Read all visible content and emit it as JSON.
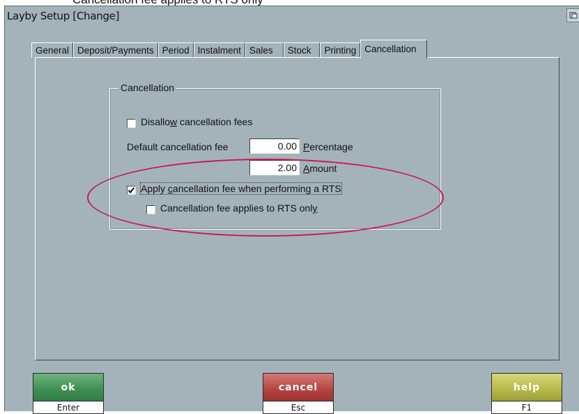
{
  "caption": "Cancellation fee applies to RTS only",
  "window": {
    "title": "Layby Setup  [Change]"
  },
  "tabs": [
    {
      "label": "General"
    },
    {
      "label": "Deposit/Payments"
    },
    {
      "label": "Period"
    },
    {
      "label": "Instalment"
    },
    {
      "label": "Sales"
    },
    {
      "label": "Stock"
    },
    {
      "label": "Printing"
    },
    {
      "label": "Cancellation",
      "active": true
    }
  ],
  "cancellation": {
    "group_title": "Cancellation",
    "disallow_fees": {
      "label_pre": "Disallo",
      "label_u": "w",
      "label_post": " cancellation fees",
      "checked": false
    },
    "default_fee_label": "Default cancellation fee",
    "percentage": {
      "value": "0.00",
      "label_u": "P",
      "label_post": "ercentage"
    },
    "amount": {
      "value": "2.00",
      "label_u": "A",
      "label_post": "mount"
    },
    "apply_rts": {
      "label_pre": "Apply ",
      "label_u": "c",
      "label_post": "ancellation fee when performing a RTS",
      "checked": true
    },
    "rts_only": {
      "label_pre": "Cancellation fee applies to RTS onl",
      "label_u": "y",
      "checked": false
    }
  },
  "buttons": {
    "ok": {
      "label": "ok",
      "key": "Enter"
    },
    "cancel": {
      "label": "cancel",
      "key": "Esc"
    },
    "help": {
      "label": "help",
      "key": "F1"
    }
  },
  "colors": {
    "background": "#a3b3b9",
    "highlight_ellipse": "#c81b52",
    "ok": "#3f8f55",
    "cancel": "#b4443f",
    "help": "#b6b84a"
  }
}
